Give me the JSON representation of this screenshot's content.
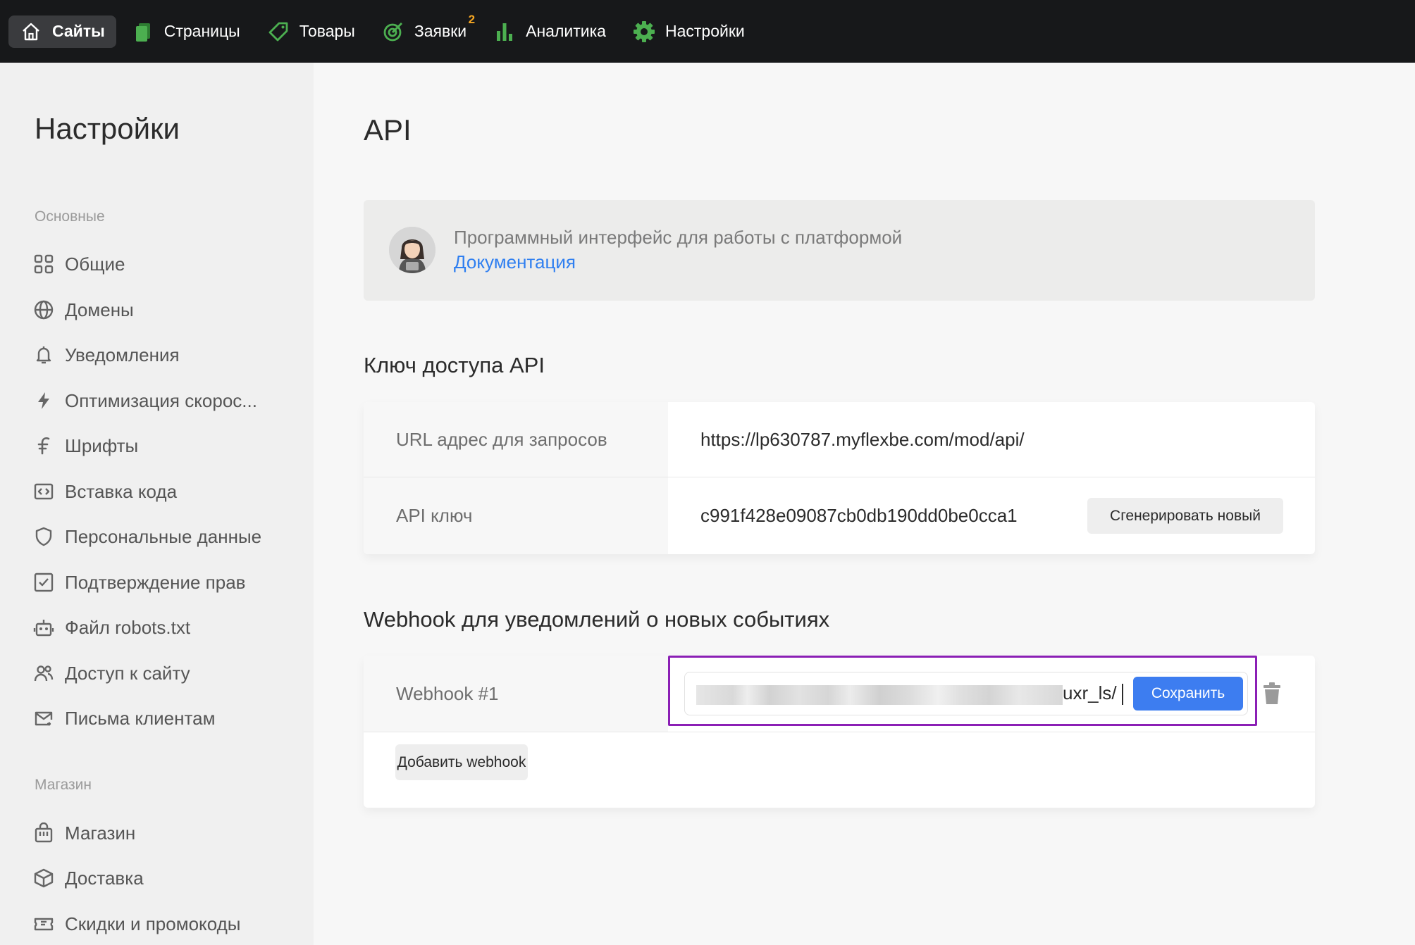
{
  "topnav": {
    "items": [
      {
        "label": "Сайты",
        "icon": "home-icon",
        "active": true
      },
      {
        "label": "Страницы",
        "icon": "pages-icon"
      },
      {
        "label": "Товары",
        "icon": "tag-icon"
      },
      {
        "label": "Заявки",
        "icon": "target-icon",
        "badge": "2"
      },
      {
        "label": "Аналитика",
        "icon": "bar-chart-icon"
      },
      {
        "label": "Настройки",
        "icon": "gear-icon"
      }
    ],
    "accent_color": "#4caf50",
    "badge_color": "#f5a623"
  },
  "sidebar": {
    "title": "Настройки",
    "group_main": "Основные",
    "items_main": [
      {
        "label": "Общие",
        "icon": "grid-icon"
      },
      {
        "label": "Домены",
        "icon": "globe-icon"
      },
      {
        "label": "Уведомления",
        "icon": "bell-icon"
      },
      {
        "label": "Оптимизация скорос...",
        "icon": "lightning-icon"
      },
      {
        "label": "Шрифты",
        "icon": "font-icon"
      },
      {
        "label": "Вставка кода",
        "icon": "code-icon"
      },
      {
        "label": "Персональные данные",
        "icon": "shield-icon"
      },
      {
        "label": "Подтверждение прав",
        "icon": "checkbox-icon"
      },
      {
        "label": "Файл robots.txt",
        "icon": "robot-icon"
      },
      {
        "label": "Доступ к сайту",
        "icon": "users-icon"
      },
      {
        "label": "Письма клиентам",
        "icon": "mail-icon"
      }
    ],
    "group_shop": "Магазин",
    "items_shop": [
      {
        "label": "Магазин",
        "icon": "shop-bag-icon"
      },
      {
        "label": "Доставка",
        "icon": "box-icon"
      },
      {
        "label": "Скидки и промокоды",
        "icon": "coupon-icon"
      }
    ]
  },
  "main": {
    "title": "API",
    "info": {
      "text": "Программный интерфейс для работы с платформой",
      "link": "Документация"
    },
    "api_key_section": {
      "title": "Ключ доступа API",
      "url_label": "URL адрес для запросов",
      "url_value": "https://lp630787.myflexbe.com/mod/api/",
      "key_label": "API ключ",
      "key_value": "c991f428e09087cb0db190dd0be0cca1",
      "regenerate_button": "Сгенерировать новый"
    },
    "webhook_section": {
      "title": "Webhook для уведомлений о новых событиях",
      "webhook_label": "Webhook #1",
      "webhook_value_visible_tail": "uxr_ls/",
      "save_button": "Сохранить",
      "add_button": "Добавить webhook",
      "highlight_color": "#8b1fb5",
      "save_color": "#3d7df0"
    }
  }
}
